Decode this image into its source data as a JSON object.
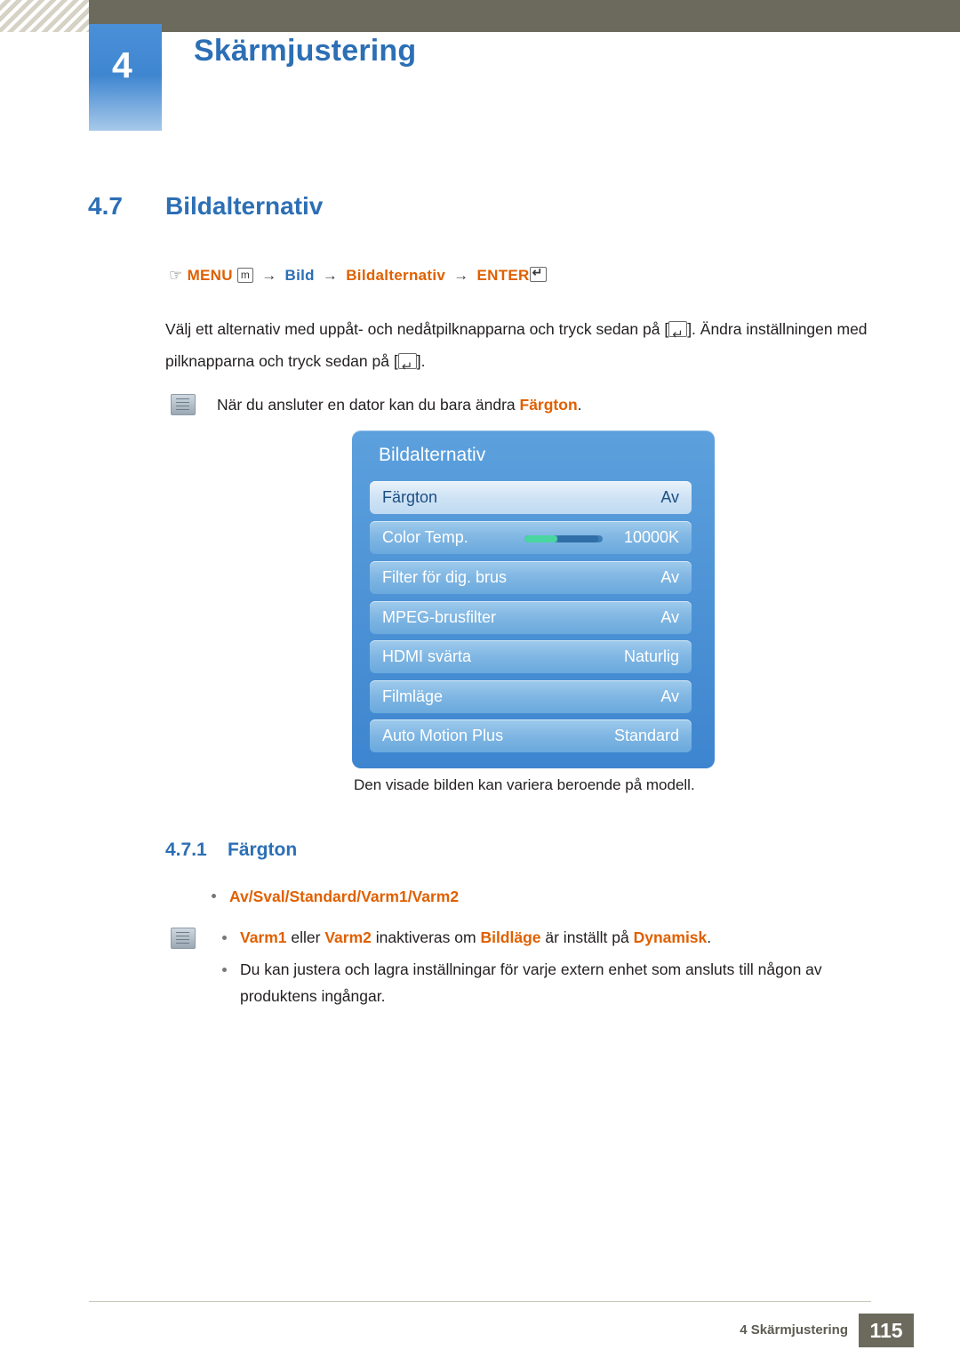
{
  "header": {
    "chapter_number": "4",
    "chapter_title": "Skärmjustering"
  },
  "section": {
    "number": "4.7",
    "title": "Bildalternativ"
  },
  "menu_path": {
    "menu_label": "MENU",
    "menu_key": "m",
    "item1": "Bild",
    "item2": "Bildalternativ",
    "enter_label": "ENTER",
    "arrow": "→"
  },
  "intro": {
    "line1": "Välj ett alternativ med uppåt- och nedåtpilknapparna och tryck sedan på [",
    "line1b": "]. Ändra inställningen med",
    "line2a": "pilknapparna och tryck sedan på [",
    "line2b": "]."
  },
  "note_top": {
    "text_before": "När du ansluter en dator kan du bara ändra ",
    "highlight": "Färgton",
    "text_after": "."
  },
  "osd": {
    "title": "Bildalternativ",
    "rows": [
      {
        "label": "Färgton",
        "value": "Av",
        "selected": true,
        "slider": false
      },
      {
        "label": "Color Temp.",
        "value": "10000K",
        "selected": false,
        "slider": true
      },
      {
        "label": "Filter för dig. brus",
        "value": "Av",
        "selected": false,
        "slider": false
      },
      {
        "label": "MPEG-brusfilter",
        "value": "Av",
        "selected": false,
        "slider": false
      },
      {
        "label": "HDMI svärta",
        "value": "Naturlig",
        "selected": false,
        "slider": false
      },
      {
        "label": "Filmläge",
        "value": "Av",
        "selected": false,
        "slider": false
      },
      {
        "label": "Auto Motion Plus",
        "value": "Standard",
        "selected": false,
        "slider": false
      }
    ],
    "caption": "Den visade bilden kan variera beroende på modell."
  },
  "subsection": {
    "number": "4.7.1",
    "title": "Färgton"
  },
  "bullets": {
    "options": "Av/Sval/Standard/Varm1/Varm2",
    "note_line": {
      "w1": "Varm1",
      "mid1": " eller ",
      "w2": "Varm2",
      "mid2": " inaktiveras om ",
      "w3": "Bildläge",
      "mid3": " är inställt på ",
      "w4": "Dynamisk",
      "end": "."
    },
    "last": "Du kan justera och lagra inställningar för varje extern enhet som ansluts till någon av produktens ingångar."
  },
  "footer": {
    "label": "4 Skärmjustering",
    "page": "115"
  }
}
